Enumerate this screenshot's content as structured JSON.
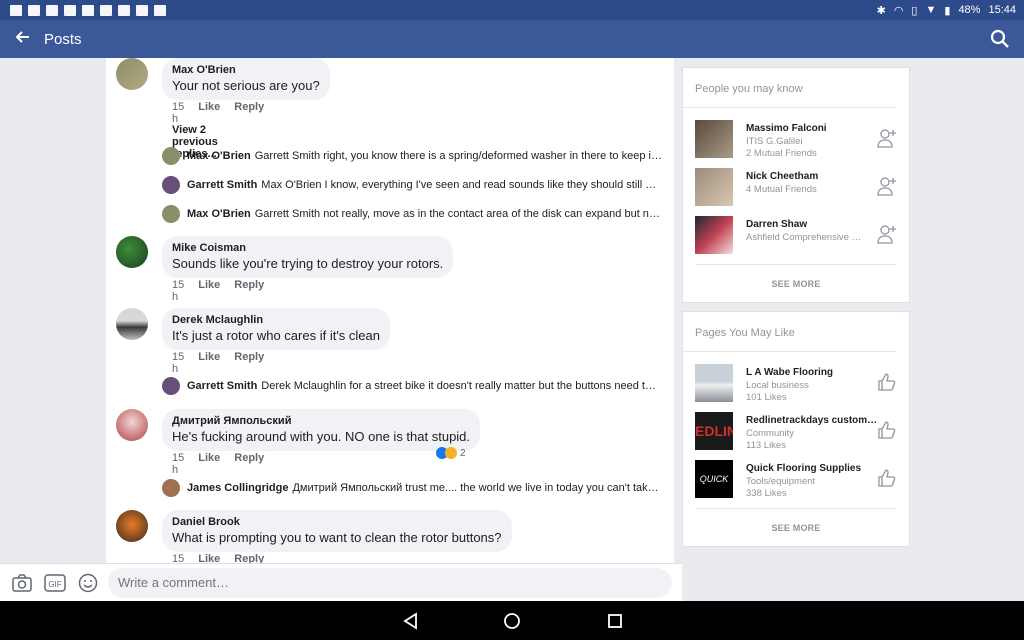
{
  "status_bar": {
    "battery": "48%",
    "time": "15:44"
  },
  "appbar": {
    "title": "Posts"
  },
  "comments": [
    {
      "name": "Max O'Brien",
      "text": "Your not serious are you?",
      "time": "15 h",
      "like": "Like",
      "reply": "Reply"
    },
    {
      "name": "Mike Coisman",
      "text": "Sounds like you're trying to destroy your rotors.",
      "time": "15 h",
      "like": "Like",
      "reply": "Reply"
    },
    {
      "name": "Derek Mclaughlin",
      "text": "It's just a rotor who cares if it's clean",
      "time": "15 h",
      "like": "Like",
      "reply": "Reply"
    },
    {
      "name": "Дмитрий Ямпольский",
      "text": "He's fucking around with you. NO one is that stupid.",
      "time": "15 h",
      "like": "Like",
      "reply": "Reply",
      "reactions": "2"
    },
    {
      "name": "Daniel Brook",
      "text": "What is prompting you to want to clean the rotor buttons?",
      "time": "15 h",
      "like": "Like",
      "reply": "Reply"
    }
  ],
  "view_previous": "View 2 previous replies...",
  "replies": [
    {
      "name": "Max O'Brien",
      "text": "Garrett Smith right, you know there is a spring/deformed washer in there to keep it ti…"
    },
    {
      "name": "Garrett Smith",
      "text": "Max O'Brien I know, everything I've seen and read sounds like they should still move…"
    },
    {
      "name": "Max O'Brien",
      "text": "Garrett Smith not really, move as in the contact area of the disk can expand but not…"
    },
    {
      "name": "Garrett Smith",
      "text": "Derek Mclaughlin for a street bike it doesn't really matter but the buttons need to be…"
    },
    {
      "name": "James Collingridge",
      "text": "Дмитрий Ямпольский trust me.... the world we live in today you can't take a…"
    }
  ],
  "composer": {
    "placeholder": "Write a comment…",
    "gif_label": "GIF"
  },
  "people": {
    "title": "People you may know",
    "items": [
      {
        "name": "Massimo Falconi",
        "line1": "ITIS G.Galilei",
        "line2": "2 Mutual Friends"
      },
      {
        "name": "Nick Cheetham",
        "line1": "4 Mutual Friends",
        "line2": ""
      },
      {
        "name": "Darren Shaw",
        "line1": "Ashfield Comprehensive S…",
        "line2": ""
      }
    ],
    "see_more": "SEE MORE"
  },
  "pages": {
    "title": "Pages You May Like",
    "items": [
      {
        "name": "L A Wabe Flooring",
        "line1": "Local business",
        "line2": "101 Likes",
        "thumb_text": ""
      },
      {
        "name": "Redlinetrackdays custom…",
        "line1": "Community",
        "line2": "113 Likes",
        "thumb_text": "EDLIN"
      },
      {
        "name": "Quick Flooring Supplies",
        "line1": "Tools/equipment",
        "line2": "338 Likes",
        "thumb_text": "QUICK"
      }
    ],
    "see_more": "SEE MORE"
  },
  "colors": {
    "brand": "#3b5998",
    "statusbar": "#2d4b8a",
    "bubble": "#f0f2f5"
  }
}
